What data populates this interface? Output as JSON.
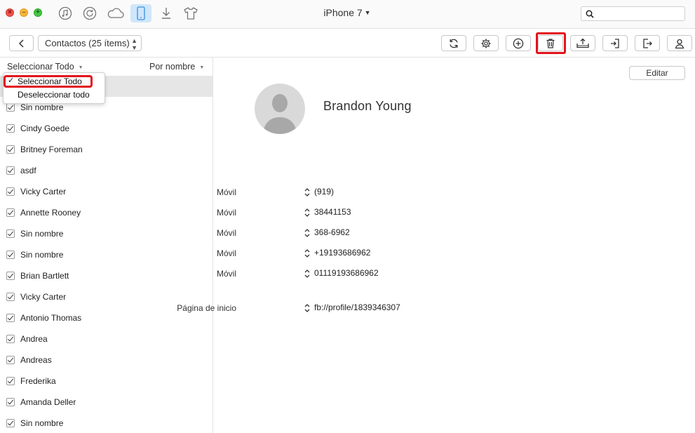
{
  "window": {
    "device_title": "iPhone 7"
  },
  "titlebar_icons": [
    "music-icon",
    "restore-icon",
    "cloud-icon",
    "phone-icon",
    "download-icon",
    "tshirt-icon"
  ],
  "toolbar": {
    "category_label": "Contactos (25 ítems)"
  },
  "list": {
    "select_all_label": "Seleccionar Todo",
    "sort_label": "Por nombre",
    "contacts": [
      "Brandon Young",
      "Sin nombre",
      "Cindy Goede",
      "Britney Foreman",
      "asdf",
      "Vicky Carter",
      "Annette Rooney",
      "Sin nombre",
      "Sin nombre",
      "Brian Bartlett",
      "Vicky Carter",
      "Antonio Thomas",
      "Andrea",
      "Andreas",
      "Frederika",
      "Amanda Deller",
      "Sin nombre"
    ]
  },
  "dropdown": {
    "items": [
      "Seleccionar Todo",
      "Deseleccionar todo"
    ],
    "checked": "✓"
  },
  "detail": {
    "edit_label": "Editar",
    "name": "Brandon  Young",
    "fields": [
      {
        "label": "Móvil",
        "value": "(919)"
      },
      {
        "label": "Móvil",
        "value": "38441153"
      },
      {
        "label": "Móvil",
        "value": "368-6962"
      },
      {
        "label": "Móvil",
        "value": "+19193686962"
      },
      {
        "label": "Móvil",
        "value": "01119193686962"
      },
      {
        "label": "Página de inicio",
        "value": "fb://profile/1839346307"
      }
    ]
  },
  "colors": {
    "accent": "#3d8fd6",
    "highlight_red": "#e2141c",
    "selected_row": "#e6e6e6"
  }
}
